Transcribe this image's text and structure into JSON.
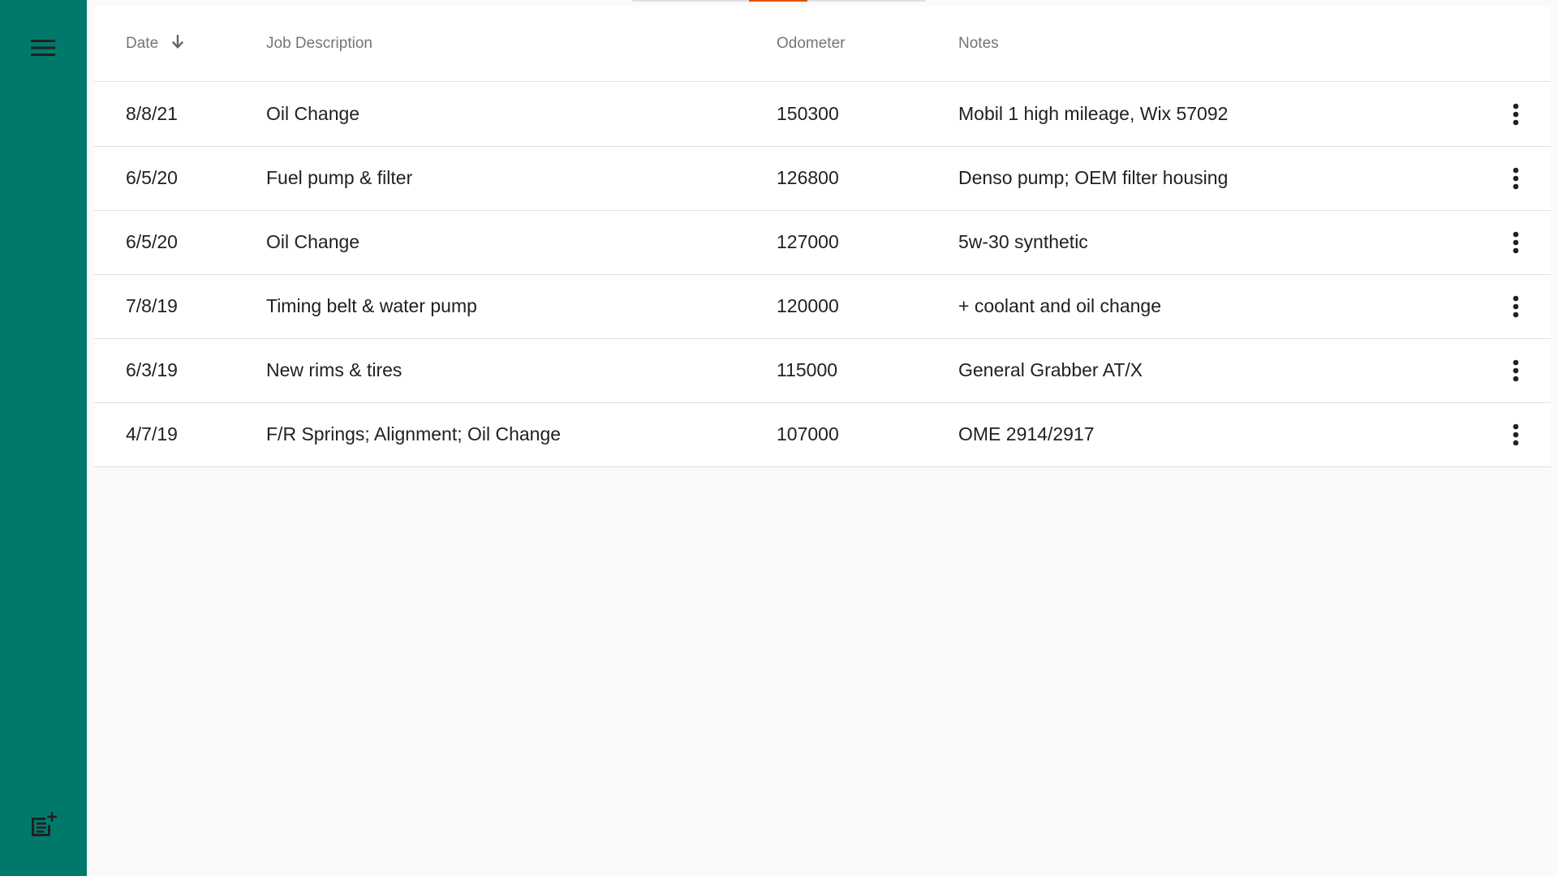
{
  "sidebar": {
    "menu_icon": "menu-icon",
    "add_icon": "add-note-icon",
    "background": "#00796b"
  },
  "table": {
    "headers": {
      "date": "Date",
      "job": "Job Description",
      "odometer": "Odometer",
      "notes": "Notes"
    },
    "sort": {
      "column": "date",
      "direction": "descending",
      "icon": "arrow-down-icon"
    },
    "rows": [
      {
        "date": "8/8/21",
        "job": "Oil Change",
        "odometer": "150300",
        "notes": "Mobil 1 high mileage, Wix 57092"
      },
      {
        "date": "6/5/20",
        "job": "Fuel pump & filter",
        "odometer": "126800",
        "notes": "Denso pump; OEM filter housing"
      },
      {
        "date": "6/5/20",
        "job": "Oil Change",
        "odometer": "127000",
        "notes": "5w-30 synthetic"
      },
      {
        "date": "7/8/19",
        "job": "Timing belt & water pump",
        "odometer": "120000",
        "notes": "+ coolant and oil change"
      },
      {
        "date": "6/3/19",
        "job": "New rims & tires",
        "odometer": "115000",
        "notes": "General Grabber AT/X"
      },
      {
        "date": "4/7/19",
        "job": "F/R Springs; Alignment; Oil Change",
        "odometer": "107000",
        "notes": "OME 2914/2917"
      }
    ],
    "row_action_icon": "more-vert-icon"
  },
  "colors": {
    "accent": "#00796b",
    "progress": "#e65100"
  }
}
